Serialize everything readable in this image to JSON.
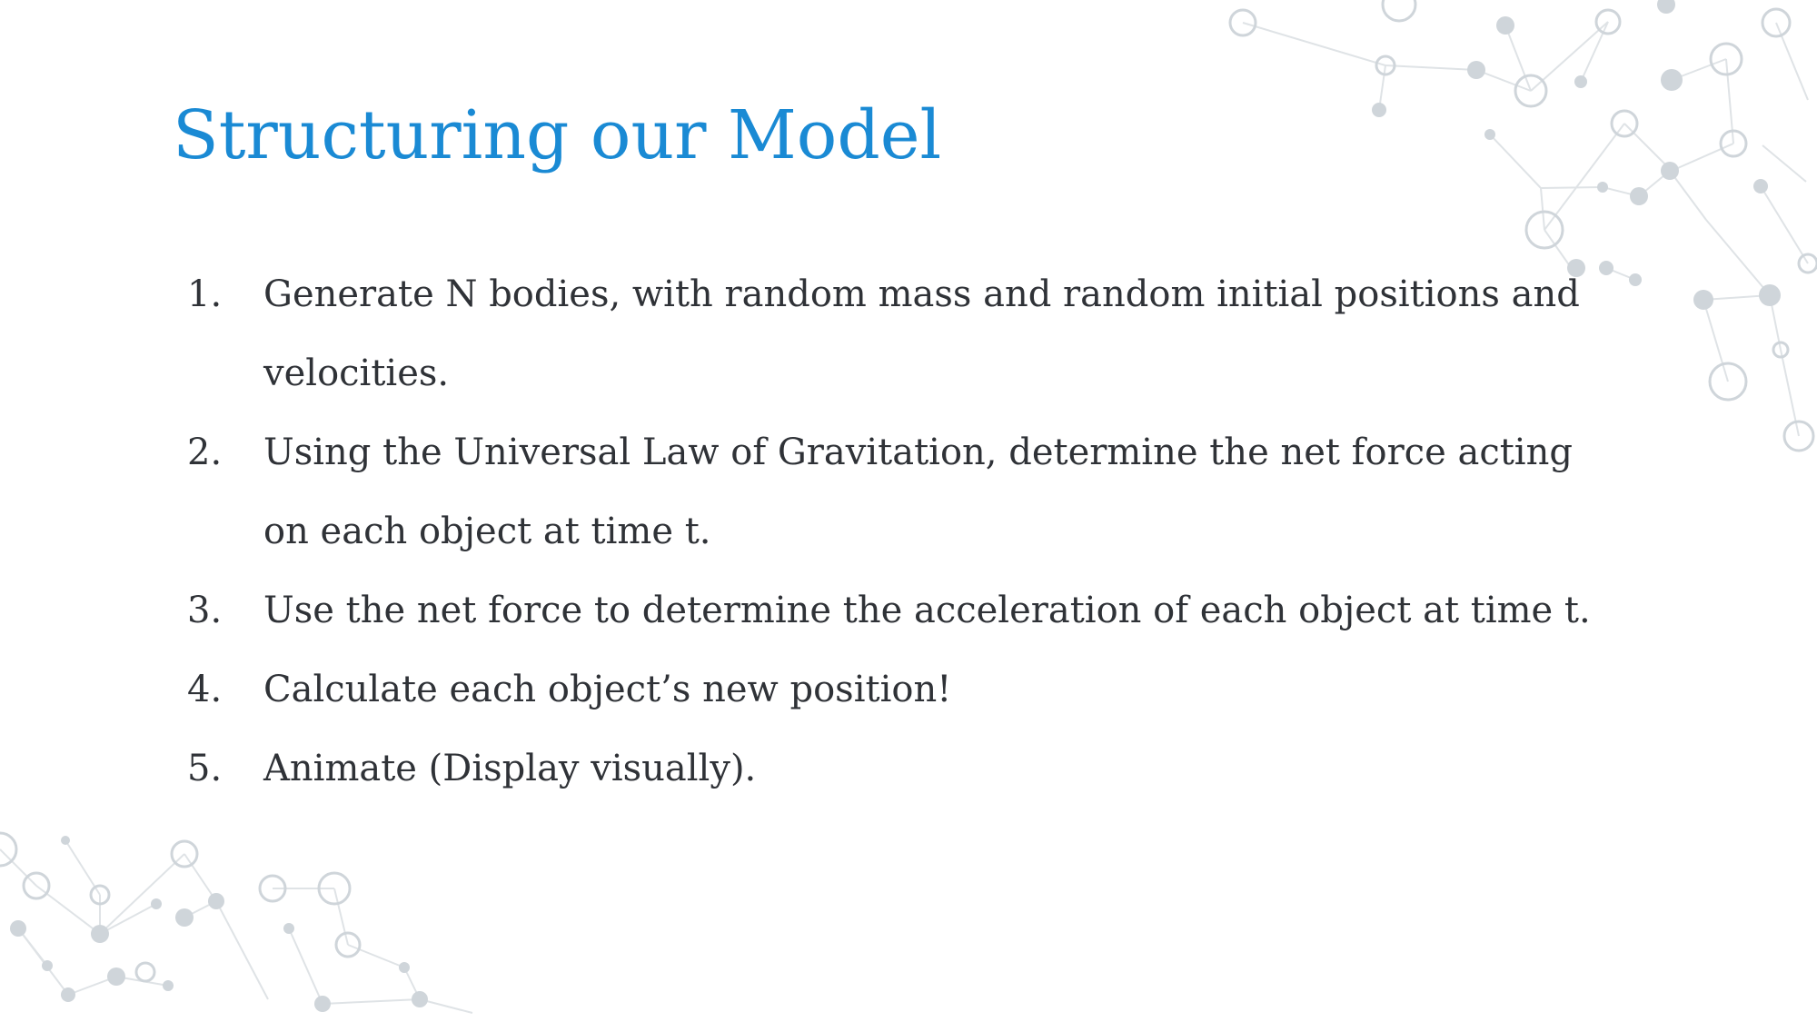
{
  "slide": {
    "title": "Structuring our Model",
    "steps": [
      {
        "number": "1.",
        "text": "Generate N bodies, with random mass and random initial positions and velocities."
      },
      {
        "number": "2.",
        "text": "Using the Universal Law of Gravitation, determine the net force acting on each object at time t."
      },
      {
        "number": "3.",
        "text": "Use the net force to determine the acceleration of each object at time t."
      },
      {
        "number": "4.",
        "text": "Calculate each object’s new position!"
      },
      {
        "number": "5.",
        "text": "Animate (Display visually)."
      }
    ]
  },
  "colors": {
    "title": "#1a8ad4",
    "body_text": "#2f3237",
    "decor_lines": "#dfe3e6",
    "decor_nodes": "#cfd5da"
  },
  "decor": {
    "icon": "molecular-network-icon"
  }
}
